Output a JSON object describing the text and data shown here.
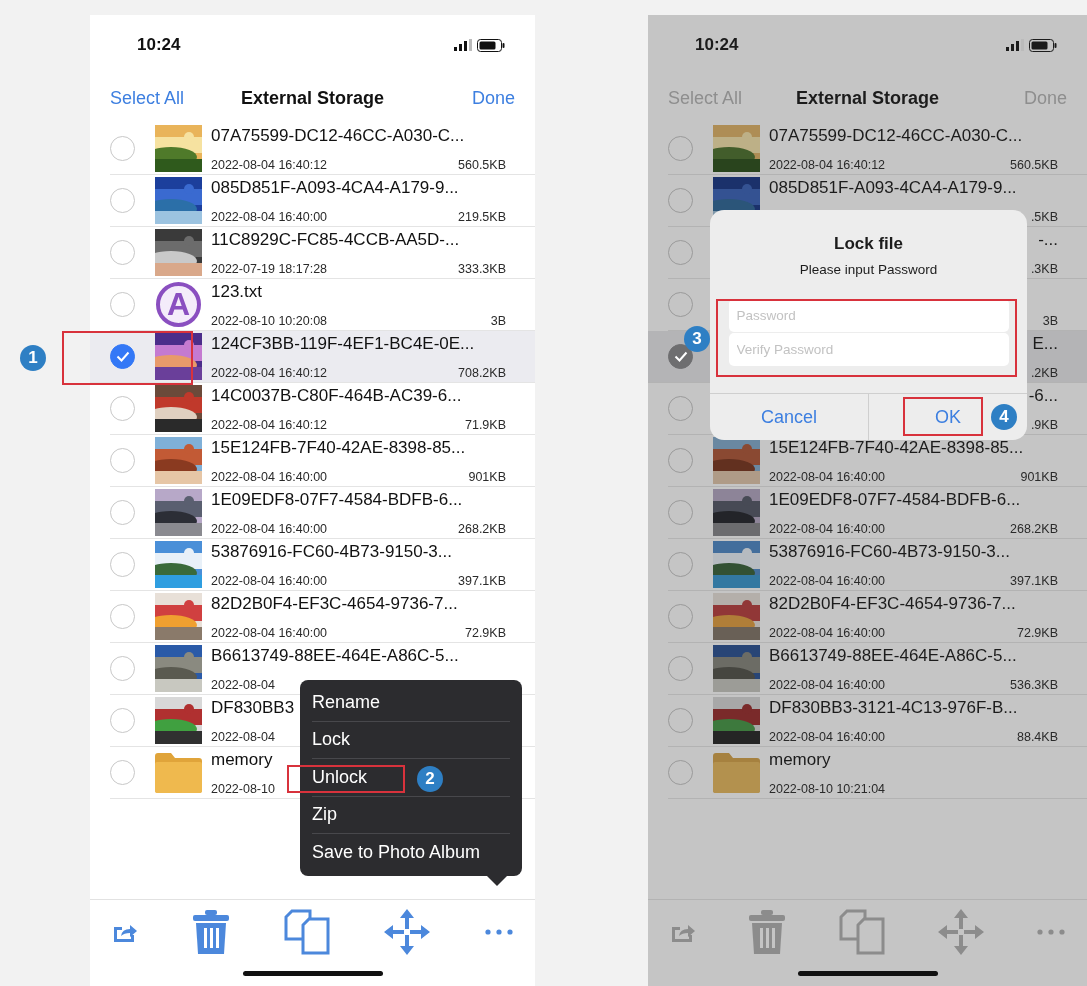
{
  "screens": [
    {
      "dimmed": false,
      "status": {
        "time": "10:24"
      },
      "nav": {
        "left": "Select All",
        "title": "External Storage",
        "right": "Done"
      },
      "rows": [
        {
          "name": "07A75599-DC12-46CC-A030-C...",
          "date": "2022-08-04 16:40:12",
          "size": "560.5KB",
          "checked": false
        },
        {
          "name": "085D851F-A093-4CA4-A179-9...",
          "date": "2022-08-04 16:40:00",
          "size": "219.5KB",
          "checked": false
        },
        {
          "name": "11C8929C-FC85-4CCB-AA5D-...",
          "date": "2022-07-19 18:17:28",
          "size": "333.3KB",
          "checked": false
        },
        {
          "kind": "text-file",
          "icon_letter": "A",
          "name": "123.txt",
          "date": "2022-08-10 10:20:08",
          "size": "3B",
          "checked": false
        },
        {
          "name": "124CF3BB-119F-4EF1-BC4E-0E...",
          "date": "2022-08-04 16:40:12",
          "size": "708.2KB",
          "checked": true
        },
        {
          "name": "14C0037B-C80F-464B-AC39-6...",
          "date": "2022-08-04 16:40:12",
          "size": "71.9KB",
          "checked": false
        },
        {
          "name": "15E124FB-7F40-42AE-8398-85...",
          "date": "2022-08-04 16:40:00",
          "size": "901KB",
          "checked": false
        },
        {
          "name": "1E09EDF8-07F7-4584-BDFB-6...",
          "date": "2022-08-04 16:40:00",
          "size": "268.2KB",
          "checked": false
        },
        {
          "name": "53876916-FC60-4B73-9150-3...",
          "date": "2022-08-04 16:40:00",
          "size": "397.1KB",
          "checked": false
        },
        {
          "name": "82D2B0F4-EF3C-4654-9736-7...",
          "date": "2022-08-04 16:40:00",
          "size": "72.9KB",
          "checked": false
        },
        {
          "name": "B6613749-88EE-464E-A86C-5...",
          "date": "2022-08-04",
          "checked": false
        },
        {
          "name": "DF830BB3",
          "date": "2022-08-04",
          "checked": false
        },
        {
          "kind": "folder",
          "name": "memory",
          "date": "2022-08-10",
          "checked": false
        }
      ],
      "menu": {
        "items": [
          "Rename",
          "Lock",
          "Unlock",
          "Zip",
          "Save to Photo Album"
        ]
      }
    },
    {
      "dimmed": true,
      "status": {
        "time": "10:24"
      },
      "nav": {
        "left": "Select All",
        "title": "External Storage",
        "right": "Done"
      },
      "rows": [
        {
          "name": "07A75599-DC12-46CC-A030-C...",
          "date": "2022-08-04 16:40:12",
          "size": "560.5KB",
          "checked": false
        },
        {
          "name": "085D851F-A093-4CA4-A179-9...",
          "size": ".5KB",
          "checked": false
        },
        {
          "kind": "covered",
          "name": "-...",
          "clipped": true,
          "size": ".3KB",
          "checked": false
        },
        {
          "kind": "covered",
          "size": "3B",
          "checked": false
        },
        {
          "kind": "covered",
          "name": "E...",
          "clipped": true,
          "size": ".2KB",
          "checked": true
        },
        {
          "kind": "covered",
          "name": "-6...",
          "clipped": true,
          "size": ".9KB",
          "checked": false
        },
        {
          "name": "15E124FB-7F40-42AE-8398-85...",
          "date": "2022-08-04 16:40:00",
          "size": "901KB",
          "checked": false
        },
        {
          "name": "1E09EDF8-07F7-4584-BDFB-6...",
          "date": "2022-08-04 16:40:00",
          "size": "268.2KB",
          "checked": false
        },
        {
          "name": "53876916-FC60-4B73-9150-3...",
          "date": "2022-08-04 16:40:00",
          "size": "397.1KB",
          "checked": false
        },
        {
          "name": "82D2B0F4-EF3C-4654-9736-7...",
          "date": "2022-08-04 16:40:00",
          "size": "72.9KB",
          "checked": false
        },
        {
          "name": "B6613749-88EE-464E-A86C-5...",
          "date": "2022-08-04 16:40:00",
          "size": "536.3KB",
          "checked": false
        },
        {
          "name": "DF830BB3-3121-4C13-976F-B...",
          "date": "2022-08-04 16:40:00",
          "size": "88.4KB",
          "checked": false
        },
        {
          "kind": "folder",
          "name": "memory",
          "date": "2022-08-10 10:21:04",
          "checked": false
        }
      ],
      "dialog": {
        "title": "Lock file",
        "message": "Please input Password",
        "fields": [
          {
            "placeholder": "Password"
          },
          {
            "placeholder": "Verify Password"
          }
        ],
        "buttons": [
          "Cancel",
          "OK"
        ]
      }
    }
  ],
  "callouts": [
    "1",
    "2",
    "3",
    "4"
  ]
}
